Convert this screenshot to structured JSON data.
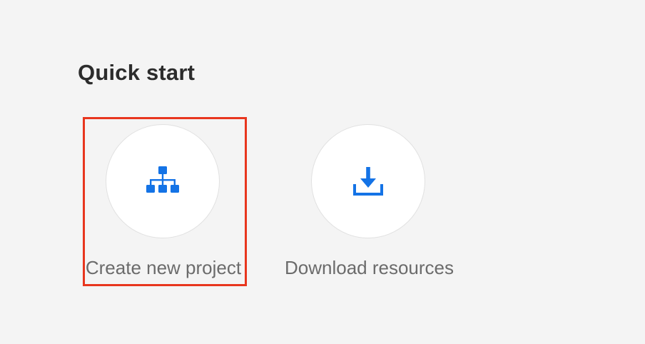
{
  "quick_start": {
    "title": "Quick start",
    "actions": [
      {
        "label": "Create new project",
        "icon": "hierarchy-icon",
        "selected": true
      },
      {
        "label": "Download resources",
        "icon": "download-icon",
        "selected": false
      }
    ]
  },
  "colors": {
    "background": "#f4f4f4",
    "icon_blue": "#1473e6",
    "highlight_red": "#e8361e",
    "title_text": "#2c2c2c",
    "label_text": "#6b6b6b"
  }
}
